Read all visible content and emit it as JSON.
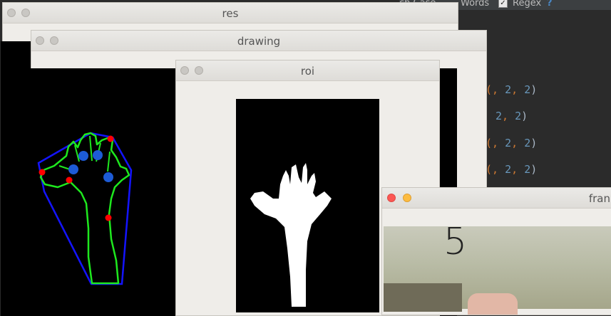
{
  "editor": {
    "find_bar": {
      "match_case_fragment": "ch Case",
      "words_label": "Words",
      "regex_label": "Regex",
      "help_label": "?"
    },
    "code_lines": [
      {
        "prefix": "(",
        "a": "2",
        "b": "2"
      },
      {
        "prefix": "",
        "a": "2",
        "b": "2"
      },
      {
        "prefix": "(",
        "a": "2",
        "b": "2"
      },
      {
        "prefix": "(",
        "a": "2",
        "b": "2"
      }
    ]
  },
  "windows": {
    "res": {
      "title": "res"
    },
    "drawing": {
      "title": "drawing"
    },
    "roi": {
      "title": "roi"
    },
    "frame": {
      "title_fragment": "fran",
      "finger_count": "5"
    }
  },
  "colors": {
    "contour": "#1ee81e",
    "hull": "#1414ff",
    "defect_points": "#ff0000",
    "centers": "#1d5bd6",
    "close_button": "#fc5753",
    "minimize_button": "#fdbc40"
  }
}
